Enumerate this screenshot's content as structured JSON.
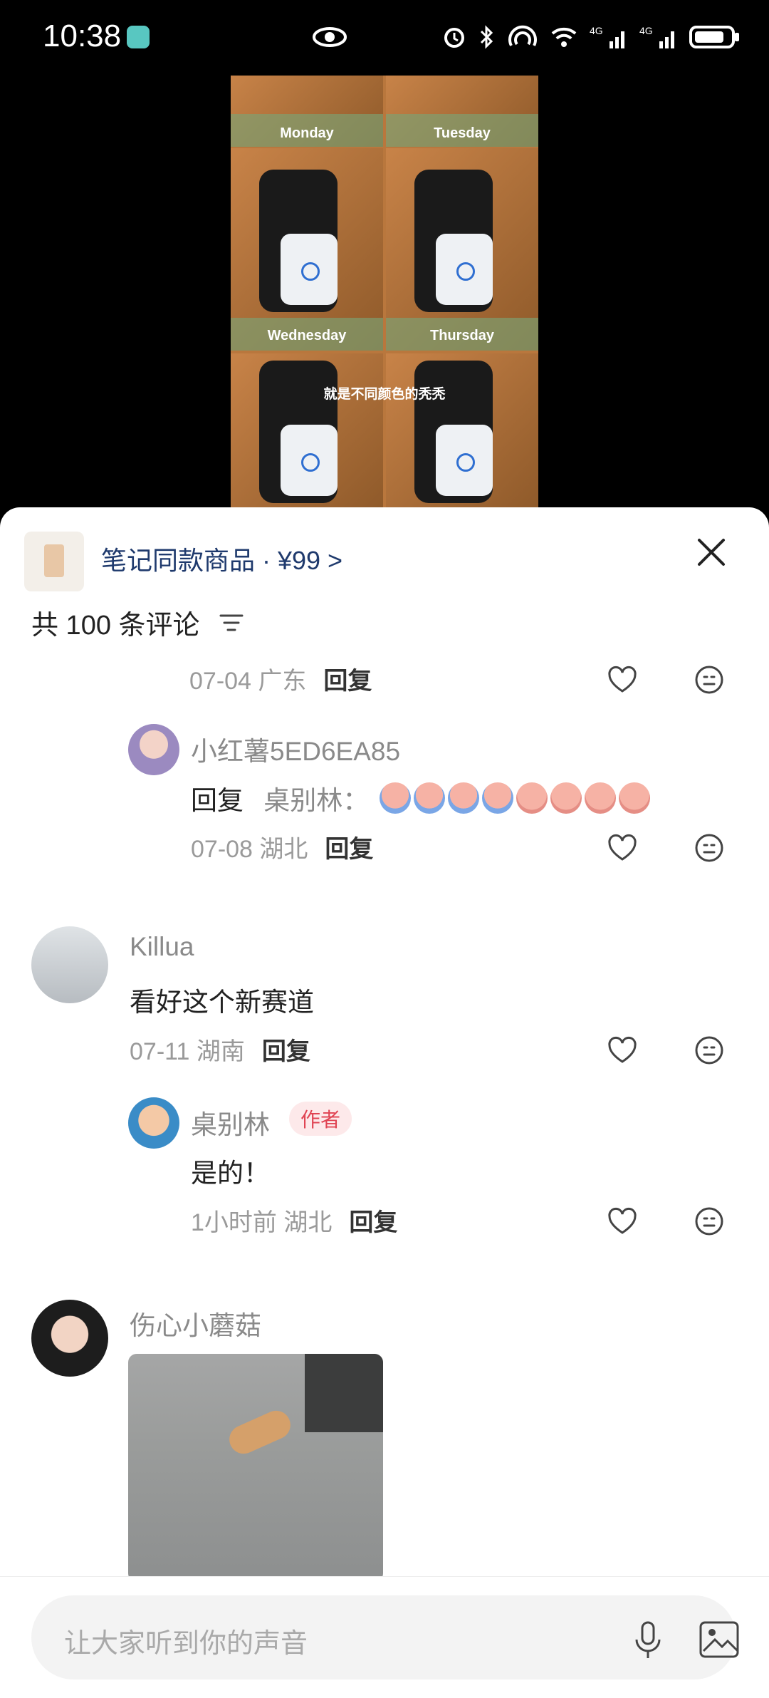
{
  "status_bar": {
    "time": "10:38",
    "icons": [
      "eye-icon",
      "alarm-icon",
      "bluetooth-icon",
      "nfc-icon",
      "wifi-icon",
      "4g-signal-icon",
      "4g-signal-icon",
      "battery-icon"
    ]
  },
  "video": {
    "days": [
      "Monday",
      "Tuesday",
      "Wednesday",
      "Thursday"
    ],
    "caption": "就是不同颜色的秃秃"
  },
  "product": {
    "title": "笔记同款商品 · ¥99 >"
  },
  "comments_header": {
    "count_text": "共 100 条评论"
  },
  "comments": [
    {
      "partial_meta": "07-04 广东",
      "reply_label": "回复"
    },
    {
      "username": "小红薯5ED6EA85",
      "text_prefix": "回复",
      "reply_to": "桌别林：",
      "meta": "07-08 湖北",
      "reply_label": "回复"
    },
    {
      "username": "Killua",
      "text": "看好这个新赛道",
      "meta": "07-11 湖南",
      "reply_label": "回复"
    },
    {
      "username": "桌别林",
      "badge": "作者",
      "text": "是的！",
      "meta": "1小时前 湖北",
      "reply_label": "回复"
    },
    {
      "username": "伤心小蘑菇"
    }
  ],
  "composer": {
    "placeholder": "让大家听到你的声音"
  }
}
